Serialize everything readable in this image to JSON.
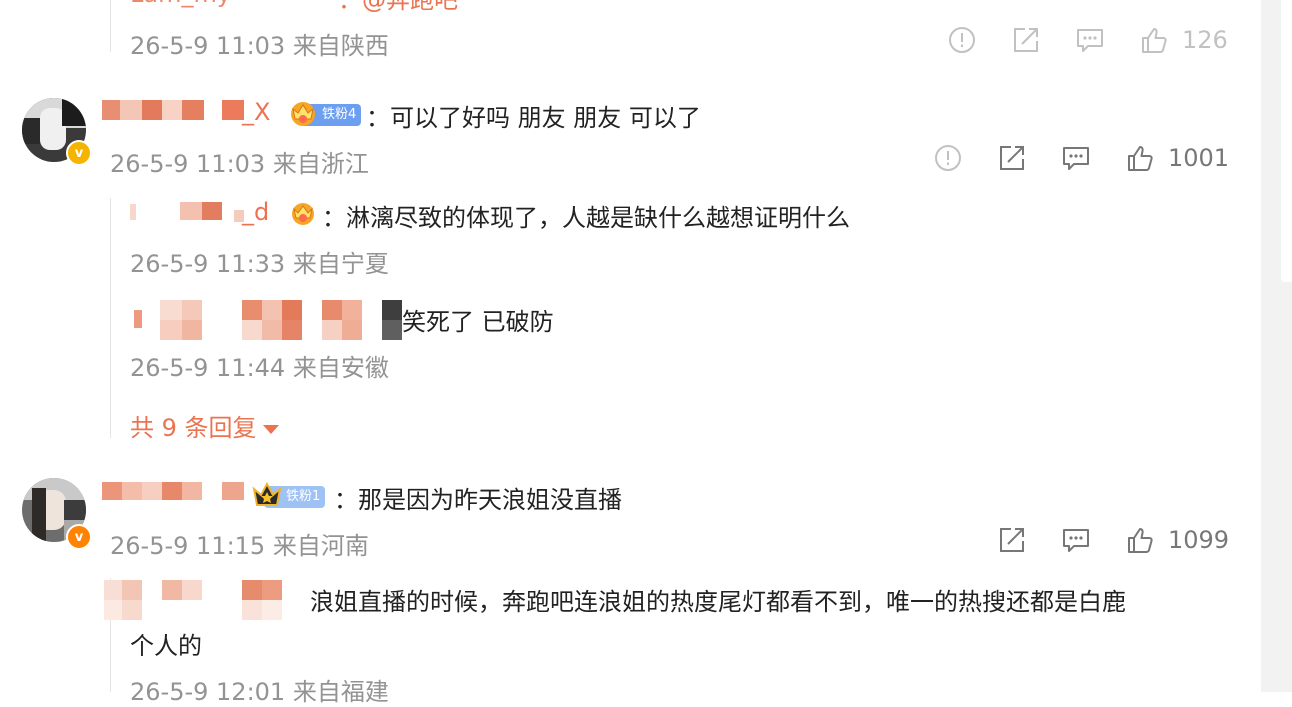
{
  "colors": {
    "accent_orange": "#eb7350",
    "meta_gray": "#939393",
    "fan_badge_blue": "#6c9ff0",
    "verified_gold": "#f5b400",
    "verified_orange": "#ff8200"
  },
  "top_partial": {
    "author": "Lam_my",
    "text": "：@奔跑吧",
    "meta": "26-5-9 11:03 来自陕西",
    "like_count": "126"
  },
  "comments": [
    {
      "author_suffix": "_X",
      "fan_badge": "铁粉4",
      "text": "：可以了好吗 朋友 朋友 可以了",
      "meta": "26-5-9 11:03 来自浙江",
      "like_count": "1001",
      "verified": "gold",
      "replies": [
        {
          "author_suffix": "_d",
          "text": "：淋漓尽致的体现了，人越是缺什么越想证明什么",
          "meta": "26-5-9 11:33 来自宁夏"
        },
        {
          "text": "笑死了 已破防",
          "meta": "26-5-9 11:44 来自安徽"
        }
      ],
      "more_replies": "共 9 条回复"
    },
    {
      "fan_badge": "铁粉1",
      "text": "：那是因为昨天浪姐没直播",
      "meta": "26-5-9 11:15 来自河南",
      "like_count": "1099",
      "verified": "orange",
      "replies": [
        {
          "text_line1": "浪姐直播的时候，奔跑吧连浪姐的热度尾灯都看不到，唯一的热搜还都是白鹿",
          "text_line2": "个人的",
          "meta": "26-5-9 12:01 来自福建"
        }
      ]
    }
  ],
  "icons": {
    "report": "report-icon",
    "share": "share-icon",
    "comment": "comment-icon",
    "like": "like-icon"
  }
}
